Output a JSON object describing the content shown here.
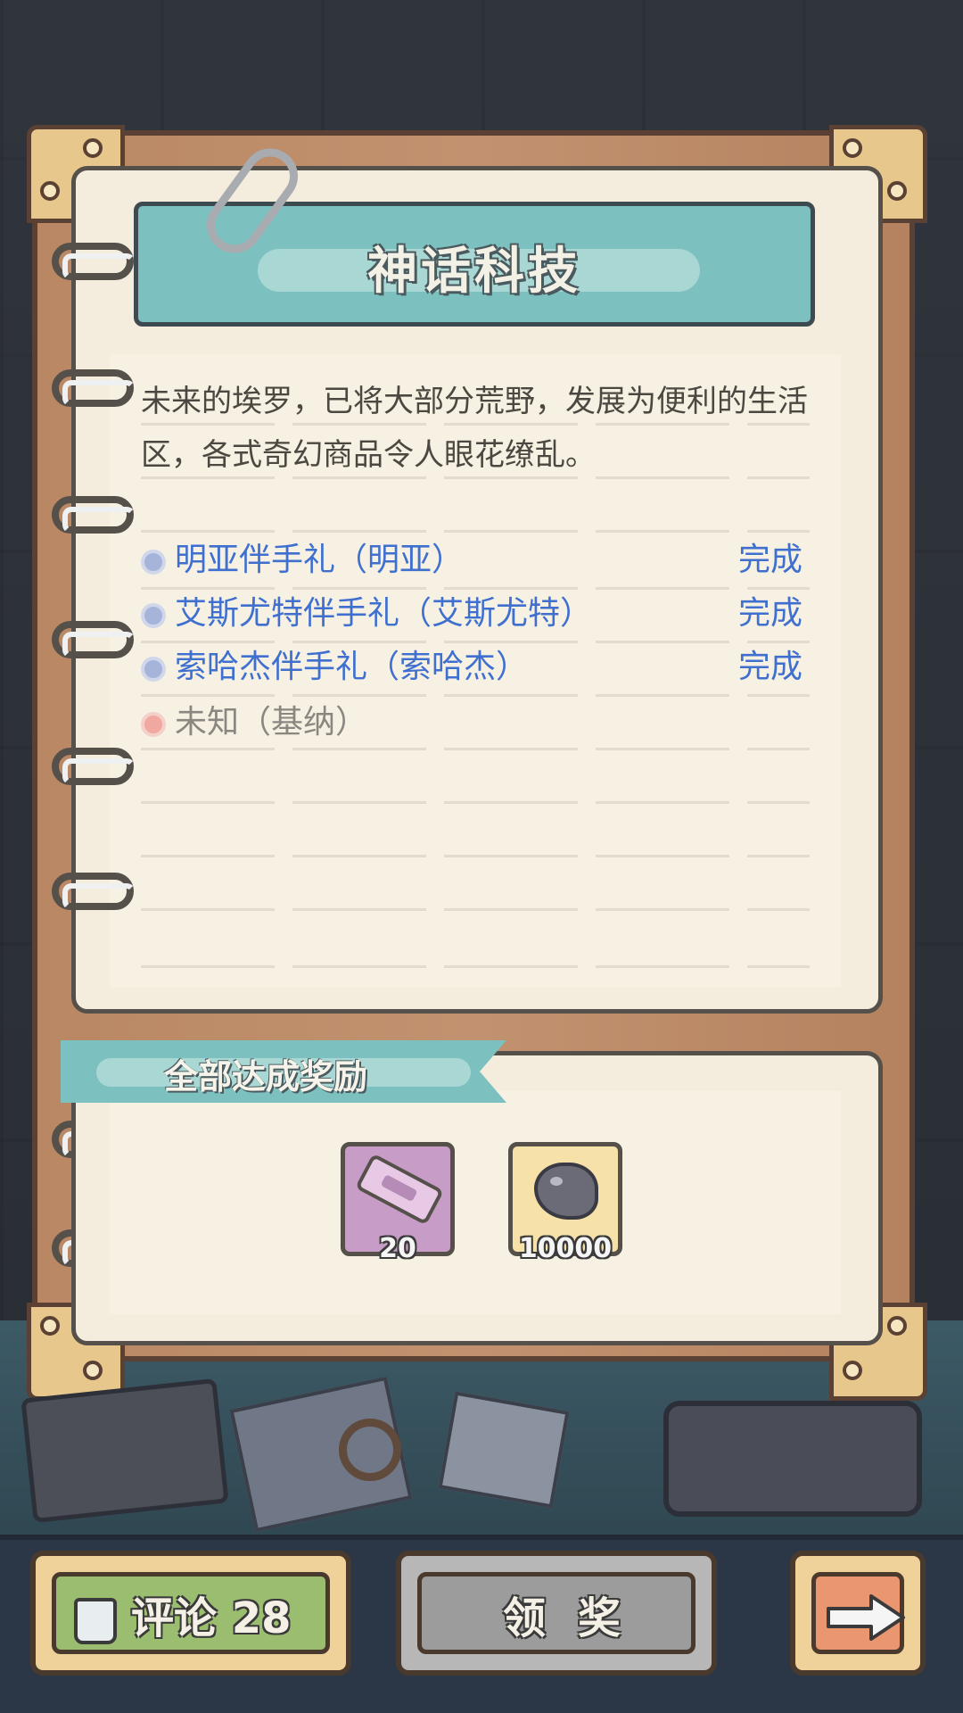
{
  "header": {
    "title": "神话科技"
  },
  "description": "未来的埃罗，已将大部分荒野，发展为便利的生活区，各式奇幻商品令人眼花缭乱。",
  "tasks": [
    {
      "name": "明亚伴手礼（明亚）",
      "status": "完成",
      "state": "done"
    },
    {
      "name": "艾斯尤特伴手礼（艾斯尤特）",
      "status": "完成",
      "state": "done"
    },
    {
      "name": "索哈杰伴手礼（索哈杰）",
      "status": "完成",
      "state": "done"
    },
    {
      "name": "未知（基纳）",
      "status": "",
      "state": "unknown"
    }
  ],
  "rewards": {
    "title": "全部达成奖励",
    "items": [
      {
        "icon": "telescope-icon",
        "count": "20"
      },
      {
        "icon": "ghost-coin-icon",
        "count": "10000"
      }
    ]
  },
  "buttons": {
    "comment_label": "评论 28",
    "claim_label": "领奖"
  },
  "colors": {
    "done": "#3f6fcf",
    "unknown": "#8a8680",
    "banner": "#7cc0c0",
    "comment_button": "#9bbd6f",
    "next_button": "#ea9670"
  }
}
